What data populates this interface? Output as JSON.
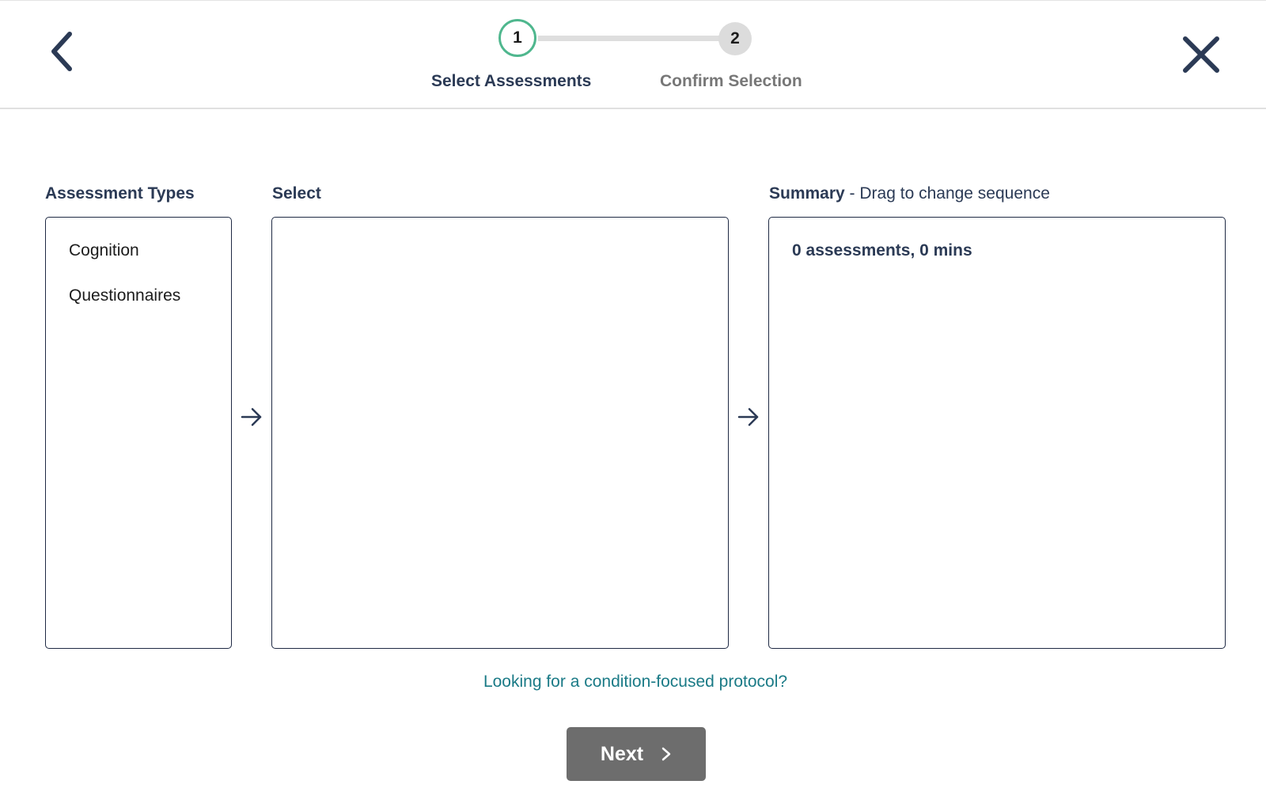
{
  "header": {
    "steps": [
      {
        "number": "1",
        "label": "Select Assessments",
        "state": "active"
      },
      {
        "number": "2",
        "label": "Confirm Selection",
        "state": "inactive"
      }
    ],
    "icons": {
      "back": "chevron-left-icon",
      "close": "close-icon"
    }
  },
  "columns": {
    "types": {
      "heading": "Assessment Types",
      "items": [
        "Cognition",
        "Questionnaires"
      ]
    },
    "select": {
      "heading": "Select"
    },
    "summary": {
      "heading": "Summary",
      "subheading": " - Drag to change sequence",
      "count_text": "0 assessments, 0 mins"
    }
  },
  "footer": {
    "protocol_link": "Looking for a condition-focused protocol?",
    "next_label": "Next"
  },
  "colors": {
    "primary_text": "#2b3a55",
    "active_step": "#4fb78e",
    "link": "#1a7a86",
    "disabled_button": "#6d6d6d"
  }
}
